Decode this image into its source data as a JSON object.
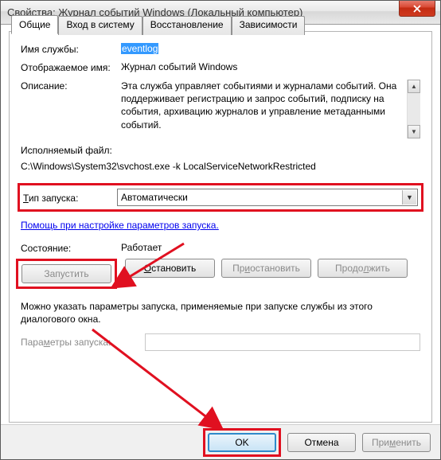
{
  "window": {
    "title": "Свойства: Журнал событий Windows (Локальный компьютер)"
  },
  "tabs": {
    "general": "Общие",
    "logon": "Вход в систему",
    "recovery": "Восстановление",
    "deps": "Зависимости"
  },
  "labels": {
    "service_name": "Имя службы:",
    "display_name": "Отображаемое имя:",
    "description": "Описание:",
    "exe_path": "Исполняемый файл:",
    "startup_type": "Тип запуска:",
    "status": "Состояние:",
    "params": "Параметры запуска:"
  },
  "values": {
    "service_name": "eventlog",
    "display_name": "Журнал событий Windows",
    "description": "Эта служба управляет событиями и журналами событий. Она поддерживает регистрацию и запрос событий, подписку на события, архивацию журналов и управление метаданными событий.",
    "exe_path": "C:\\Windows\\System32\\svchost.exe -k LocalServiceNetworkRestricted",
    "startup_type": "Автоматически",
    "status": "Работает"
  },
  "link": "Помощь при настройке параметров запуска.",
  "buttons": {
    "start": "Запустить",
    "stop": "Остановить",
    "pause": "Приостановить",
    "resume": "Продолжить",
    "ok": "OK",
    "cancel": "Отмена",
    "apply": "Применить"
  },
  "hint": "Можно указать параметры запуска, применяемые при запуске службы из этого диалогового окна."
}
